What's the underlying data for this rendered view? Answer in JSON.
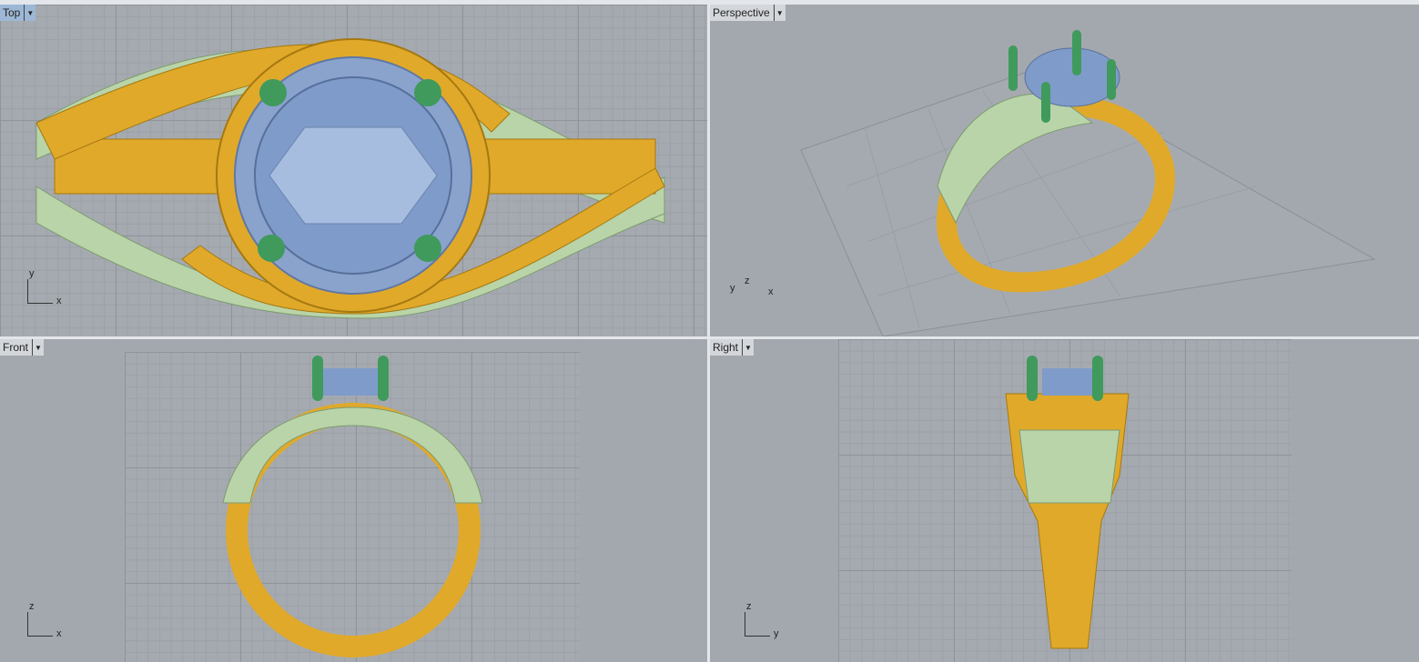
{
  "viewports": [
    {
      "name": "Top",
      "active": true,
      "axis_h": "x",
      "axis_v": "y"
    },
    {
      "name": "Perspective",
      "active": false,
      "axis_h": "x",
      "axis_v": "z",
      "axis_extra": "y"
    },
    {
      "name": "Front",
      "active": false,
      "axis_h": "x",
      "axis_v": "z"
    },
    {
      "name": "Right",
      "active": false,
      "axis_h": "y",
      "axis_v": "z"
    }
  ],
  "icons": {
    "dropdown": "triangle-down-icon"
  },
  "colors": {
    "gold": "#e0a92a",
    "stone": "#7f9bc9",
    "green_prong": "#3f9a5c",
    "light_green": "#b8d4a8",
    "active_label": "#9db8d6",
    "background": "#a3a8ae"
  }
}
